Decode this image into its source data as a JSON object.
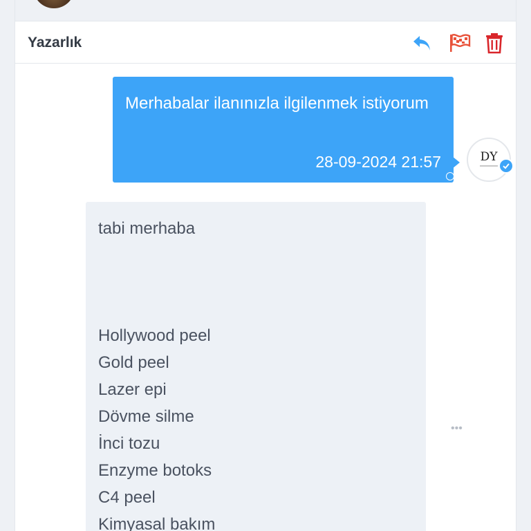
{
  "header": {
    "title": "Yazarlık",
    "actions": [
      "reply-icon",
      "report-flag-icon",
      "trash-icon"
    ]
  },
  "messages": [
    {
      "direction": "sent",
      "text": "Merhabalar ilanınızla ilgilenmek istiyorum",
      "timestamp": "28-09-2024 21:57",
      "avatar_text": "DY",
      "verified": true
    },
    {
      "direction": "received",
      "greeting": "tabi merhaba",
      "items": [
        "Hollywood peel",
        "Gold peel",
        "Lazer epi",
        "Dövme silme",
        "İnci tozu",
        "Enzyme botoks",
        "C4 peel",
        "Kimyasal bakım"
      ]
    }
  ],
  "more_menu_label": "•••",
  "colors": {
    "sent_bubble": "#3da4f8",
    "received_bubble": "#edf1f6",
    "reply_icon": "#3da4f8",
    "flag_icon": "#e8523a",
    "trash_icon": "#d9262b"
  }
}
